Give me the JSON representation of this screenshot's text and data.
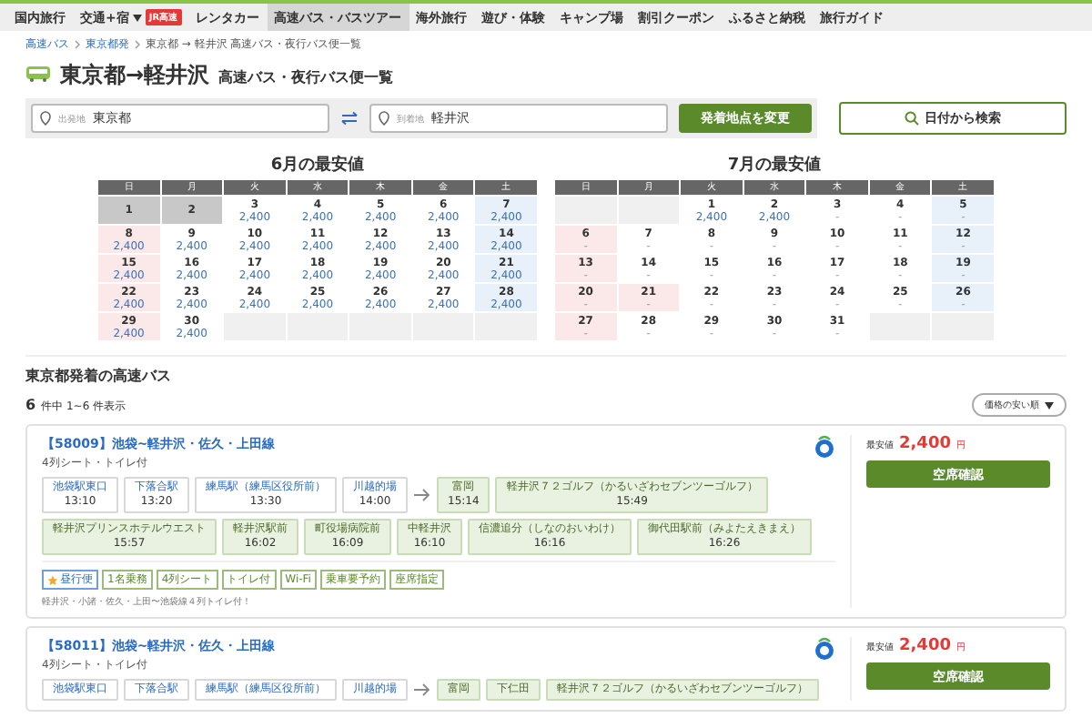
{
  "nav": {
    "items": [
      {
        "label": "国内旅行",
        "selected": false
      },
      {
        "label": "交通+宿",
        "selected": false,
        "dropdown": true,
        "badge": "JR高速"
      },
      {
        "label": "レンタカー",
        "selected": false
      },
      {
        "label": "高速バス・バスツアー",
        "selected": true
      },
      {
        "label": "海外旅行",
        "selected": false
      },
      {
        "label": "遊び・体験",
        "selected": false
      },
      {
        "label": "キャンプ場",
        "selected": false
      },
      {
        "label": "割引クーポン",
        "selected": false
      },
      {
        "label": "ふるさと納税",
        "selected": false
      },
      {
        "label": "旅行ガイド",
        "selected": false
      }
    ]
  },
  "breadcrumb": [
    {
      "label": "高速バス",
      "link": true
    },
    {
      "label": "東京都発",
      "link": true
    },
    {
      "label": "東京都 → 軽井沢 高速バス・夜行バス便一覧",
      "link": false
    }
  ],
  "title": {
    "route": "東京都→軽井沢",
    "subtitle": "高速バス・夜行バス便一覧"
  },
  "search": {
    "from": {
      "label": "出発地",
      "value": "東京都"
    },
    "to": {
      "label": "到着地",
      "value": "軽井沢"
    },
    "change_button": "発着地点を変更",
    "date_button": "日付から検索"
  },
  "calendars": [
    {
      "title": "6月の最安値",
      "weekdays": [
        "日",
        "月",
        "火",
        "水",
        "木",
        "金",
        "土"
      ],
      "weeks": [
        [
          {
            "kind": "day",
            "date": "1",
            "disabled": true
          },
          {
            "kind": "day",
            "date": "2",
            "disabled": true
          },
          {
            "date": "3",
            "price": "2,400",
            "disabled": false,
            "holiday": false
          },
          {
            "date": "4",
            "price": "2,400",
            "disabled": false,
            "holiday": false
          },
          {
            "date": "5",
            "price": "2,400",
            "disabled": false,
            "holiday": false
          },
          {
            "date": "6",
            "price": "2,400",
            "disabled": false,
            "holiday": false
          },
          {
            "date": "7",
            "price": "2,400",
            "disabled": false,
            "holiday": false
          }
        ],
        [
          {
            "date": "8",
            "price": "2,400",
            "disabled": false,
            "holiday": true
          },
          {
            "date": "9",
            "price": "2,400",
            "disabled": false,
            "holiday": false
          },
          {
            "date": "10",
            "price": "2,400",
            "disabled": false,
            "holiday": false
          },
          {
            "date": "11",
            "price": "2,400",
            "disabled": false,
            "holiday": false
          },
          {
            "date": "12",
            "price": "2,400",
            "disabled": false,
            "holiday": false
          },
          {
            "date": "13",
            "price": "2,400",
            "disabled": false,
            "holiday": false
          },
          {
            "date": "14",
            "price": "2,400",
            "disabled": false,
            "holiday": false
          }
        ],
        [
          {
            "date": "15",
            "price": "2,400",
            "disabled": false,
            "holiday": true
          },
          {
            "date": "16",
            "price": "2,400",
            "disabled": false,
            "holiday": false
          },
          {
            "date": "17",
            "price": "2,400",
            "disabled": false,
            "holiday": false
          },
          {
            "date": "18",
            "price": "2,400",
            "disabled": false,
            "holiday": false
          },
          {
            "date": "19",
            "price": "2,400",
            "disabled": false,
            "holiday": false
          },
          {
            "date": "20",
            "price": "2,400",
            "disabled": false,
            "holiday": false
          },
          {
            "date": "21",
            "price": "2,400",
            "disabled": false,
            "holiday": false
          }
        ],
        [
          {
            "date": "22",
            "price": "2,400",
            "disabled": false,
            "holiday": true
          },
          {
            "date": "23",
            "price": "2,400",
            "disabled": false,
            "holiday": false
          },
          {
            "date": "24",
            "price": "2,400",
            "disabled": false,
            "holiday": false
          },
          {
            "date": "25",
            "price": "2,400",
            "disabled": false,
            "holiday": false
          },
          {
            "date": "26",
            "price": "2,400",
            "disabled": false,
            "holiday": false
          },
          {
            "date": "27",
            "price": "2,400",
            "disabled": false,
            "holiday": false
          },
          {
            "date": "28",
            "price": "2,400",
            "disabled": false,
            "holiday": false
          }
        ],
        [
          {
            "date": "29",
            "price": "2,400",
            "disabled": false,
            "holiday": true
          },
          {
            "date": "30",
            "price": "2,400",
            "disabled": false,
            "holiday": false
          },
          {
            "kind": "blank"
          },
          {
            "kind": "blank"
          },
          {
            "kind": "blank"
          },
          {
            "kind": "blank"
          },
          {
            "kind": "blank"
          }
        ]
      ]
    },
    {
      "title": "7月の最安値",
      "weekdays": [
        "日",
        "月",
        "火",
        "水",
        "木",
        "金",
        "土"
      ],
      "weeks": [
        [
          {
            "kind": "blank"
          },
          {
            "kind": "blank"
          },
          {
            "date": "1",
            "price": "2,400",
            "disabled": false,
            "holiday": false
          },
          {
            "date": "2",
            "price": "2,400",
            "disabled": false,
            "holiday": false
          },
          {
            "date": "3",
            "price": "-",
            "disabled": false,
            "holiday": false
          },
          {
            "date": "4",
            "price": "-",
            "disabled": false,
            "holiday": false
          },
          {
            "date": "5",
            "price": "-",
            "disabled": false,
            "holiday": false
          }
        ],
        [
          {
            "date": "6",
            "price": "-",
            "disabled": false,
            "holiday": true
          },
          {
            "date": "7",
            "price": "-",
            "disabled": false,
            "holiday": false
          },
          {
            "date": "8",
            "price": "-",
            "disabled": false,
            "holiday": false
          },
          {
            "date": "9",
            "price": "-",
            "disabled": false,
            "holiday": false
          },
          {
            "date": "10",
            "price": "-",
            "disabled": false,
            "holiday": false
          },
          {
            "date": "11",
            "price": "-",
            "disabled": false,
            "holiday": false
          },
          {
            "date": "12",
            "price": "-",
            "disabled": false,
            "holiday": false
          }
        ],
        [
          {
            "date": "13",
            "price": "-",
            "disabled": false,
            "holiday": true
          },
          {
            "date": "14",
            "price": "-",
            "disabled": false,
            "holiday": false
          },
          {
            "date": "15",
            "price": "-",
            "disabled": false,
            "holiday": false
          },
          {
            "date": "16",
            "price": "-",
            "disabled": false,
            "holiday": false
          },
          {
            "date": "17",
            "price": "-",
            "disabled": false,
            "holiday": false
          },
          {
            "date": "18",
            "price": "-",
            "disabled": false,
            "holiday": false
          },
          {
            "date": "19",
            "price": "-",
            "disabled": false,
            "holiday": false
          }
        ],
        [
          {
            "date": "20",
            "price": "-",
            "disabled": false,
            "holiday": true
          },
          {
            "date": "21",
            "price": "-",
            "disabled": false,
            "holiday": true
          },
          {
            "date": "22",
            "price": "-",
            "disabled": false,
            "holiday": false
          },
          {
            "date": "23",
            "price": "-",
            "disabled": false,
            "holiday": false
          },
          {
            "date": "24",
            "price": "-",
            "disabled": false,
            "holiday": false
          },
          {
            "date": "25",
            "price": "-",
            "disabled": false,
            "holiday": false
          },
          {
            "date": "26",
            "price": "-",
            "disabled": false,
            "holiday": false
          }
        ],
        [
          {
            "date": "27",
            "price": "-",
            "disabled": false,
            "holiday": true
          },
          {
            "date": "28",
            "price": "-",
            "disabled": false,
            "holiday": false
          },
          {
            "date": "29",
            "price": "-",
            "disabled": false,
            "holiday": false
          },
          {
            "date": "30",
            "price": "-",
            "disabled": false,
            "holiday": false
          },
          {
            "date": "31",
            "price": "-",
            "disabled": false,
            "holiday": false
          },
          {
            "kind": "blank"
          },
          {
            "kind": "blank"
          }
        ]
      ]
    }
  ],
  "results": {
    "heading": "東京都発着の高速バス",
    "total": "6",
    "count_text": "件中 1~6 件表示",
    "sort": "価格の安い順"
  },
  "routes": [
    {
      "title": "【58009】池袋~軽井沢・佐久・上田線",
      "subtitle": "4列シート・トイレ付",
      "price_label": "最安値",
      "price": "2,400",
      "unit": "円",
      "button": "空席確認",
      "departures": [
        {
          "name": "池袋駅東口",
          "time": "13:10"
        },
        {
          "name": "下落合駅",
          "time": "13:20"
        },
        {
          "name": "練馬駅（練馬区役所前）",
          "time": "13:30"
        },
        {
          "name": "川越的場",
          "time": "14:00"
        }
      ],
      "arrivals": [
        {
          "name": "富岡",
          "time": "15:14"
        },
        {
          "name": "軽井沢７２ゴルフ（かるいざわセブンツーゴルフ）",
          "time": "15:49"
        },
        {
          "name": "軽井沢プリンスホテルウエスト",
          "time": "15:57"
        },
        {
          "name": "軽井沢駅前",
          "time": "16:02"
        },
        {
          "name": "町役場病院前",
          "time": "16:09"
        },
        {
          "name": "中軽井沢",
          "time": "16:10"
        },
        {
          "name": "信濃追分（しなのおいわけ）",
          "time": "16:16"
        },
        {
          "name": "御代田駅前（みよたえきまえ）",
          "time": "16:26"
        }
      ],
      "tags": [
        {
          "label": "昼行便",
          "kind": "feature"
        },
        {
          "label": "1名乗務",
          "kind": "plain"
        },
        {
          "label": "4列シート",
          "kind": "plain"
        },
        {
          "label": "トイレ付",
          "kind": "plain"
        },
        {
          "label": "Wi-Fi",
          "kind": "plain"
        },
        {
          "label": "乗車要予約",
          "kind": "plain"
        },
        {
          "label": "座席指定",
          "kind": "plain"
        }
      ],
      "note": "軽井沢・小諸・佐久・上田〜池袋線４列トイレ付！"
    },
    {
      "title": "【58011】池袋~軽井沢・佐久・上田線",
      "subtitle": "4列シート・トイレ付",
      "price_label": "最安値",
      "price": "2,400",
      "unit": "円",
      "button": "空席確認",
      "departures": [
        {
          "name": "池袋駅東口"
        },
        {
          "name": "下落合駅"
        },
        {
          "name": "練馬駅（練馬区役所前）"
        },
        {
          "name": "川越的場"
        }
      ],
      "arrivals": [
        {
          "name": "富岡"
        },
        {
          "name": "下仁田"
        },
        {
          "name": "軽井沢７２ゴルフ（かるいざわセブンツーゴルフ）"
        }
      ]
    }
  ]
}
